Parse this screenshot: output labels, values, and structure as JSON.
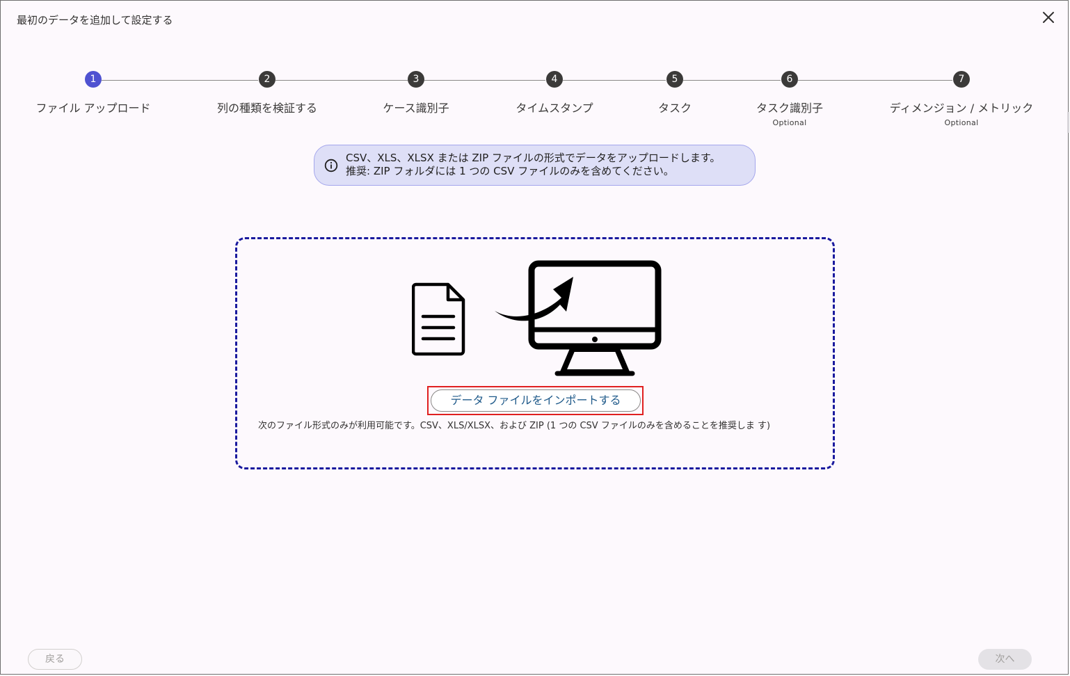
{
  "dialog": {
    "title": "最初のデータを追加して設定する"
  },
  "stepper": {
    "active_index": 1,
    "steps": [
      {
        "number": "1",
        "label": "ファイル アップロード",
        "optional": ""
      },
      {
        "number": "2",
        "label": "列の種類を検証する",
        "optional": ""
      },
      {
        "number": "3",
        "label": "ケース識別子",
        "optional": ""
      },
      {
        "number": "4",
        "label": "タイムスタンプ",
        "optional": ""
      },
      {
        "number": "5",
        "label": "タスク",
        "optional": ""
      },
      {
        "number": "6",
        "label": "タスク識別子",
        "optional": "Optional"
      },
      {
        "number": "7",
        "label": "ディメンジョン / メトリック",
        "optional": "Optional"
      }
    ]
  },
  "info": {
    "icon": "info-icon",
    "line1": "CSV、XLS、XLSX または ZIP ファイルの形式でデータをアップロードします。",
    "line2": "推奨: ZIP フォルダには 1 つの CSV ファイルのみを含めてください。"
  },
  "dropzone": {
    "import_button_label": "データ ファイルをインポートする",
    "formats_text": "次のファイル形式のみが利用可能です。CSV、XLS/XLSX、および ZIP (1 つの CSV ファイルのみを含めることを推奨しま す)"
  },
  "footer": {
    "back_label": "戻る",
    "next_label": "次へ"
  },
  "colors": {
    "active_step": "#4f52d1",
    "step": "#3b3a39",
    "info_bg": "#dedff7",
    "dropzone_border": "#1a1a9e",
    "highlight": "#e02020"
  }
}
